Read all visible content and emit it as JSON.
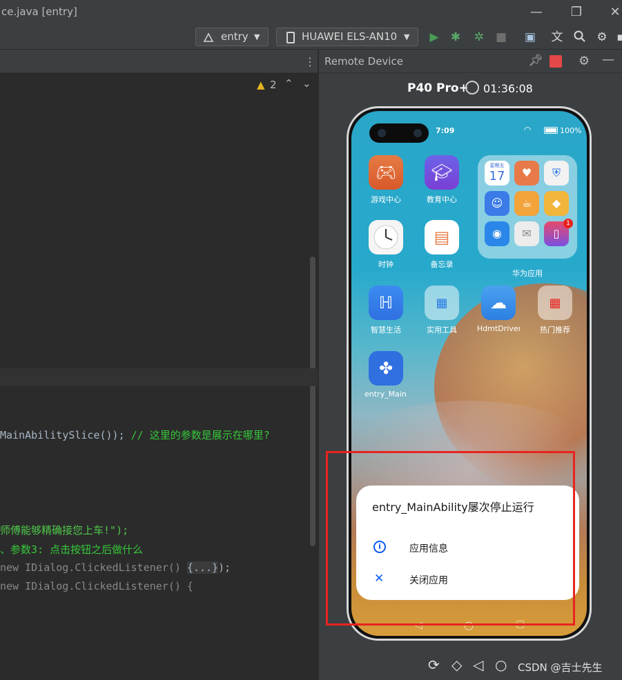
{
  "window": {
    "title": "ce.java [entry]"
  },
  "toolbar": {
    "module_combo": "entry",
    "device_combo": "HUAWEI ELS-AN10"
  },
  "editor": {
    "warnings_count": "2",
    "lines": {
      "l1_code": "MainAbilitySlice());",
      "l1_comment": " // 这里的参数是展示在哪里?",
      "l2_str": "师傅能够精确接您上车!\");",
      "l3_comment": "、参数3: 点击按钮之后做什么",
      "l4_code": "new IDialog.ClickedListener() ",
      "l4_fold": "{...}",
      "l4_end": ");",
      "l5_code": "new IDialog.ClickedListener() {"
    }
  },
  "panel": {
    "title": "Remote Device",
    "device_name": "P40 Pro+",
    "session_time": "01:36:08"
  },
  "phone": {
    "status": {
      "time": "7:09",
      "battery": "100%"
    },
    "apps": {
      "games": "游戏中心",
      "education": "教育中心",
      "clock": "时钟",
      "memo": "备忘录",
      "huawei_folder": "华为应用",
      "smart_life": "智慧生活",
      "tools": "实用工具",
      "hdmt": "HdmtDriver",
      "hot": "热门推荐",
      "entry": "entry_Main..."
    },
    "calendar": {
      "weekday": "星期五",
      "day": "17"
    },
    "badge": "1",
    "dialog": {
      "title": "entry_MainAbility屡次停止运行",
      "app_info": "应用信息",
      "close_app": "关闭应用"
    }
  },
  "footer": {
    "watermark": "CSDN @吉士先生"
  },
  "colors": {
    "accent_red": "#e8231f",
    "dialog_blue": "#0a59f7",
    "run_green": "#499c54"
  }
}
